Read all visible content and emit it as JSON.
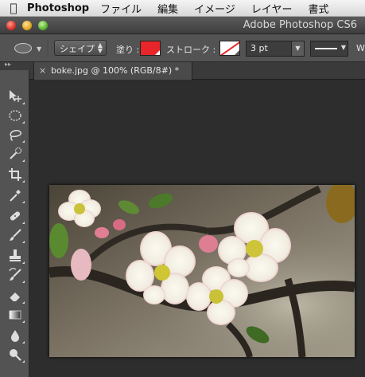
{
  "menubar": {
    "apple_icon": "apple-logo-icon",
    "app_name": "Photoshop",
    "items": [
      "ファイル",
      "編集",
      "イメージ",
      "レイヤー",
      "書式"
    ]
  },
  "window": {
    "title": "Adobe Photoshop CS6"
  },
  "options": {
    "mode_label": "シェイプ",
    "fill_label": "塗り :",
    "fill_color": "#e8262a",
    "stroke_label": "ストローク :",
    "stroke_width": "3 pt",
    "trailing_label": "W"
  },
  "tools": [
    "move-tool-icon",
    "ellipse-marquee-icon",
    "lasso-icon",
    "quick-selection-icon",
    "crop-icon",
    "eyedropper-icon",
    "healing-brush-icon",
    "brush-icon",
    "clone-stamp-icon",
    "history-brush-icon",
    "eraser-icon",
    "gradient-icon",
    "blur-icon",
    "dodge-icon"
  ],
  "document": {
    "tab_close": "×",
    "tab_title": "boke.jpg @ 100% (RGB/8#) *"
  }
}
